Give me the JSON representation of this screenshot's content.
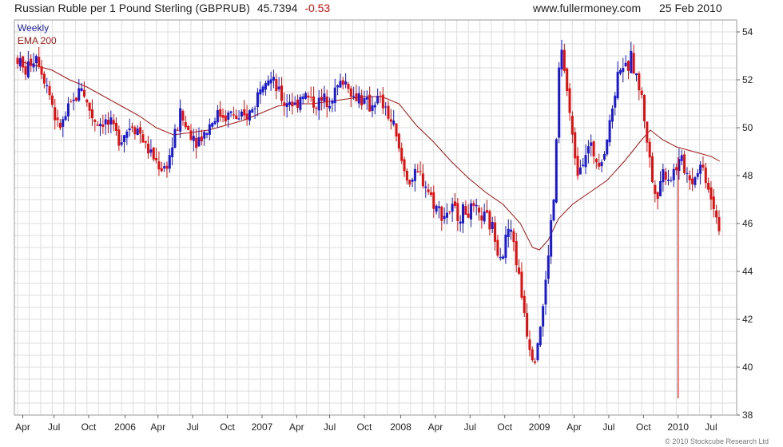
{
  "header": {
    "title": "Russian Ruble per 1 Pound Sterling (GBPRUB)",
    "last_price": "45.7394",
    "change": "-0.53",
    "site": "www.fullermoney.com",
    "date": "25 Feb 2010"
  },
  "legend": {
    "weekly": "Weekly",
    "ema": "EMA 200"
  },
  "footer": {
    "credit": "© 2010 Stockcube Research Ltd"
  },
  "colors": {
    "up": "#1a1ad0",
    "down": "#e01010",
    "ema": "#a01818",
    "grid": "#dedede",
    "frame": "#999999"
  },
  "chart_data": {
    "type": "candlestick",
    "ylim": [
      38,
      54.5
    ],
    "y_ticks": [
      38,
      40,
      42,
      44,
      46,
      48,
      50,
      52,
      54
    ],
    "x_ticks": [
      {
        "label": "Apr",
        "t": 0.15
      },
      {
        "label": "Jul",
        "t": 1.05
      },
      {
        "label": "Oct",
        "t": 2.05
      },
      {
        "label": "2006",
        "t": 3.1
      },
      {
        "label": "Apr",
        "t": 4.05
      },
      {
        "label": "Jul",
        "t": 5.05
      },
      {
        "label": "Oct",
        "t": 6.05
      },
      {
        "label": "2007",
        "t": 7.05
      },
      {
        "label": "Apr",
        "t": 8.05
      },
      {
        "label": "Jul",
        "t": 9.0
      },
      {
        "label": "Oct",
        "t": 10.0
      },
      {
        "label": "2008",
        "t": 11.05
      },
      {
        "label": "Apr",
        "t": 12.05
      },
      {
        "label": "Jul",
        "t": 13.05
      },
      {
        "label": "Oct",
        "t": 14.05
      },
      {
        "label": "2009",
        "t": 15.05
      },
      {
        "label": "Apr",
        "t": 16.05
      },
      {
        "label": "Jul",
        "t": 17.05
      },
      {
        "label": "Oct",
        "t": 18.05
      },
      {
        "label": "2010",
        "t": 19.05
      },
      {
        "label": "Jul",
        "t": 20.0
      }
    ],
    "t_range": [
      0,
      20.6
    ],
    "price_path": [
      [
        0.0,
        52.9
      ],
      [
        0.2,
        52.3
      ],
      [
        0.4,
        52.8
      ],
      [
        0.55,
        53.1
      ],
      [
        0.7,
        52.4
      ],
      [
        0.85,
        51.8
      ],
      [
        1.0,
        51.0
      ],
      [
        1.15,
        50.0
      ],
      [
        1.3,
        50.2
      ],
      [
        1.5,
        50.8
      ],
      [
        1.7,
        51.3
      ],
      [
        1.85,
        51.8
      ],
      [
        2.0,
        51.0
      ],
      [
        2.15,
        50.5
      ],
      [
        2.3,
        50.2
      ],
      [
        2.5,
        50.3
      ],
      [
        2.7,
        50.0
      ],
      [
        2.9,
        49.6
      ],
      [
        3.1,
        49.8
      ],
      [
        3.3,
        50.2
      ],
      [
        3.5,
        49.9
      ],
      [
        3.7,
        49.2
      ],
      [
        3.9,
        48.8
      ],
      [
        4.1,
        48.4
      ],
      [
        4.25,
        48.3
      ],
      [
        4.4,
        48.9
      ],
      [
        4.55,
        49.7
      ],
      [
        4.7,
        50.6
      ],
      [
        4.85,
        50.0
      ],
      [
        5.0,
        49.8
      ],
      [
        5.2,
        49.5
      ],
      [
        5.4,
        49.8
      ],
      [
        5.6,
        50.3
      ],
      [
        5.8,
        50.6
      ],
      [
        6.0,
        50.5
      ],
      [
        6.2,
        50.6
      ],
      [
        6.4,
        50.2
      ],
      [
        6.6,
        50.5
      ],
      [
        6.8,
        50.8
      ],
      [
        7.0,
        51.8
      ],
      [
        7.15,
        52.3
      ],
      [
        7.3,
        52.0
      ],
      [
        7.5,
        51.5
      ],
      [
        7.7,
        51.0
      ],
      [
        7.85,
        51.2
      ],
      [
        8.0,
        50.9
      ],
      [
        8.2,
        51.5
      ],
      [
        8.4,
        51.2
      ],
      [
        8.6,
        51.0
      ],
      [
        8.8,
        51.1
      ],
      [
        9.0,
        51.3
      ],
      [
        9.2,
        51.6
      ],
      [
        9.4,
        52.0
      ],
      [
        9.55,
        51.8
      ],
      [
        9.7,
        51.2
      ],
      [
        9.85,
        51.4
      ],
      [
        10.0,
        51.0
      ],
      [
        10.15,
        50.9
      ],
      [
        10.35,
        51.2
      ],
      [
        10.5,
        51.0
      ],
      [
        10.7,
        50.5
      ],
      [
        10.85,
        50.0
      ],
      [
        11.0,
        49.0
      ],
      [
        11.15,
        48.2
      ],
      [
        11.3,
        47.8
      ],
      [
        11.45,
        47.9
      ],
      [
        11.6,
        48.0
      ],
      [
        11.75,
        47.7
      ],
      [
        11.9,
        47.2
      ],
      [
        12.1,
        46.6
      ],
      [
        12.3,
        46.4
      ],
      [
        12.5,
        46.6
      ],
      [
        12.7,
        46.4
      ],
      [
        12.9,
        46.5
      ],
      [
        13.1,
        46.5
      ],
      [
        13.3,
        46.3
      ],
      [
        13.5,
        46.2
      ],
      [
        13.7,
        45.8
      ],
      [
        13.85,
        45.0
      ],
      [
        14.0,
        44.8
      ],
      [
        14.15,
        45.8
      ],
      [
        14.3,
        45.3
      ],
      [
        14.45,
        43.8
      ],
      [
        14.6,
        42.5
      ],
      [
        14.75,
        41.0
      ],
      [
        14.9,
        40.4
      ],
      [
        15.05,
        41.5
      ],
      [
        15.2,
        43.0
      ],
      [
        15.35,
        45.5
      ],
      [
        15.5,
        47.5
      ],
      [
        15.6,
        52.3
      ],
      [
        15.7,
        53.2
      ],
      [
        15.85,
        51.5
      ],
      [
        16.0,
        49.5
      ],
      [
        16.15,
        48.3
      ],
      [
        16.3,
        48.8
      ],
      [
        16.5,
        49.2
      ],
      [
        16.7,
        48.7
      ],
      [
        16.9,
        48.9
      ],
      [
        17.1,
        50.3
      ],
      [
        17.25,
        51.8
      ],
      [
        17.4,
        52.8
      ],
      [
        17.55,
        52.3
      ],
      [
        17.7,
        52.9
      ],
      [
        17.85,
        52.1
      ],
      [
        18.0,
        51.2
      ],
      [
        18.15,
        49.6
      ],
      [
        18.3,
        47.8
      ],
      [
        18.45,
        47.3
      ],
      [
        18.6,
        48.2
      ],
      [
        18.8,
        47.9
      ],
      [
        19.0,
        48.4
      ],
      [
        19.15,
        48.6
      ],
      [
        19.3,
        48.1
      ],
      [
        19.5,
        47.8
      ],
      [
        19.65,
        48.5
      ],
      [
        19.8,
        48.2
      ],
      [
        19.95,
        47.4
      ],
      [
        20.1,
        46.7
      ],
      [
        20.25,
        45.74
      ]
    ],
    "ema200": [
      [
        0.0,
        52.8
      ],
      [
        0.5,
        52.6
      ],
      [
        1.0,
        52.4
      ],
      [
        1.5,
        52.0
      ],
      [
        2.0,
        51.7
      ],
      [
        2.5,
        51.3
      ],
      [
        3.0,
        50.9
      ],
      [
        3.5,
        50.5
      ],
      [
        4.0,
        50.0
      ],
      [
        4.5,
        49.7
      ],
      [
        5.0,
        49.8
      ],
      [
        5.5,
        49.9
      ],
      [
        6.0,
        50.1
      ],
      [
        6.5,
        50.3
      ],
      [
        7.0,
        50.6
      ],
      [
        7.5,
        50.9
      ],
      [
        8.0,
        51.0
      ],
      [
        8.5,
        51.0
      ],
      [
        9.0,
        51.1
      ],
      [
        9.5,
        51.2
      ],
      [
        10.0,
        51.3
      ],
      [
        10.5,
        51.3
      ],
      [
        11.0,
        51.0
      ],
      [
        11.5,
        50.1
      ],
      [
        12.0,
        49.4
      ],
      [
        12.5,
        48.6
      ],
      [
        13.0,
        47.9
      ],
      [
        13.5,
        47.3
      ],
      [
        14.0,
        46.8
      ],
      [
        14.5,
        46.0
      ],
      [
        14.85,
        45.0
      ],
      [
        15.05,
        44.9
      ],
      [
        15.3,
        45.3
      ],
      [
        15.6,
        46.2
      ],
      [
        16.0,
        46.8
      ],
      [
        16.5,
        47.3
      ],
      [
        17.0,
        47.8
      ],
      [
        17.5,
        48.6
      ],
      [
        18.0,
        49.5
      ],
      [
        18.25,
        49.9
      ],
      [
        18.6,
        49.5
      ],
      [
        19.0,
        49.2
      ],
      [
        19.5,
        49.0
      ],
      [
        20.0,
        48.8
      ],
      [
        20.25,
        48.6
      ]
    ],
    "spike": {
      "t": 19.05,
      "low": 38.7
    }
  }
}
